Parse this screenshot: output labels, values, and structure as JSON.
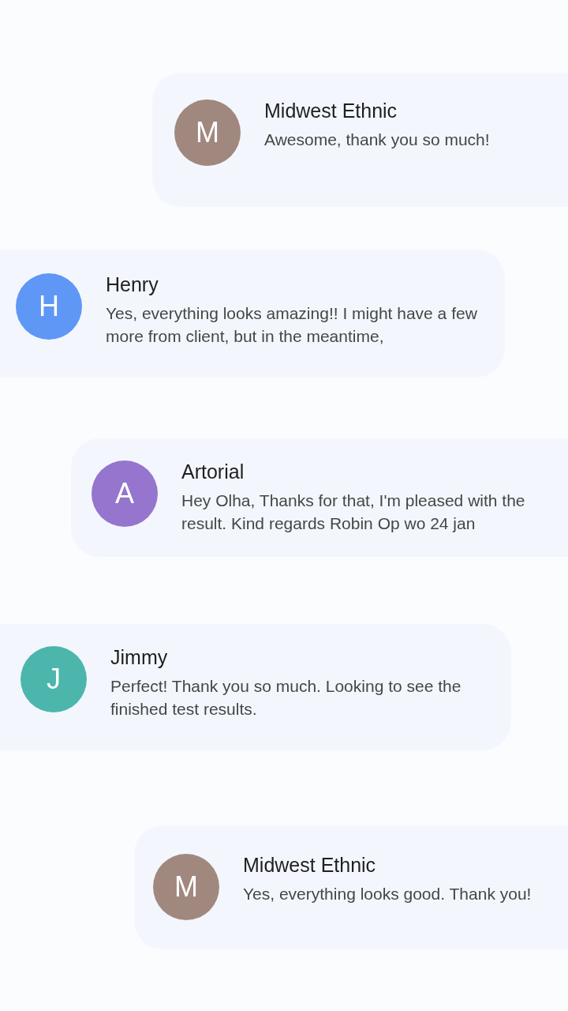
{
  "messages": [
    {
      "initial": "M",
      "color": "#a1887f",
      "sender": "Midwest Ethnic",
      "text": "Awesome, thank you so much!"
    },
    {
      "initial": "H",
      "color": "#5e97f6",
      "sender": "Henry",
      "text": "Yes, everything looks amazing!! I might have a few more from client, but in the meantime,"
    },
    {
      "initial": "A",
      "color": "#9575cd",
      "sender": "Artorial",
      "text": "Hey Olha, Thanks for that, I'm pleased with the result. Kind regards Robin Op wo 24 jan"
    },
    {
      "initial": "J",
      "color": "#4db6ac",
      "sender": "Jimmy",
      "text": "Perfect! Thank you so much. Looking to see the finished test results."
    },
    {
      "initial": "M",
      "color": "#a1887f",
      "sender": "Midwest Ethnic",
      "text": "Yes, everything looks good. Thank you!"
    }
  ]
}
